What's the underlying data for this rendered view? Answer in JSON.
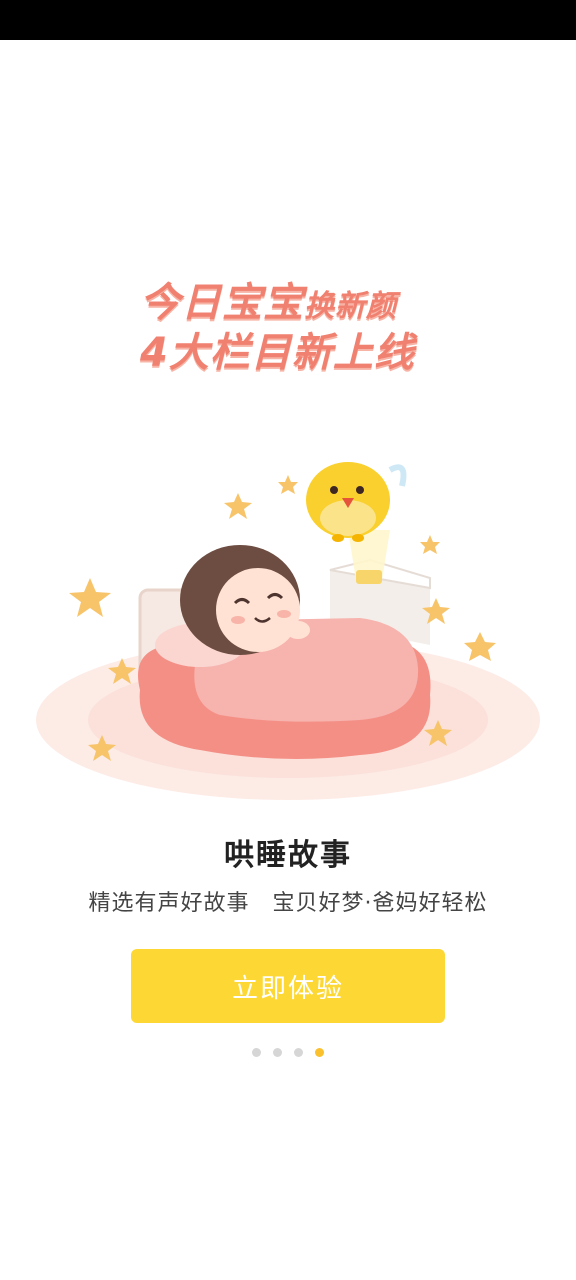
{
  "headline": {
    "line1_part1": "今日宝宝",
    "line1_part2": "换新颜",
    "line2": "4大栏目新上线"
  },
  "card": {
    "title": "哄睡故事",
    "subtitle": "精选有声好故事　宝贝好梦·爸妈好轻松"
  },
  "cta": {
    "label": "立即体验"
  },
  "pager": {
    "total": 4,
    "active_index": 3
  },
  "colors": {
    "status_bar": "#000000",
    "background": "#ffffff",
    "button": "#fdd835",
    "headline": "#f08070",
    "active_dot": "#fbc02d",
    "inactive_dot": "#d6d6d6"
  },
  "icons": [
    "star-icon",
    "chick-icon",
    "bed-illustration",
    "night-lamp-icon"
  ]
}
